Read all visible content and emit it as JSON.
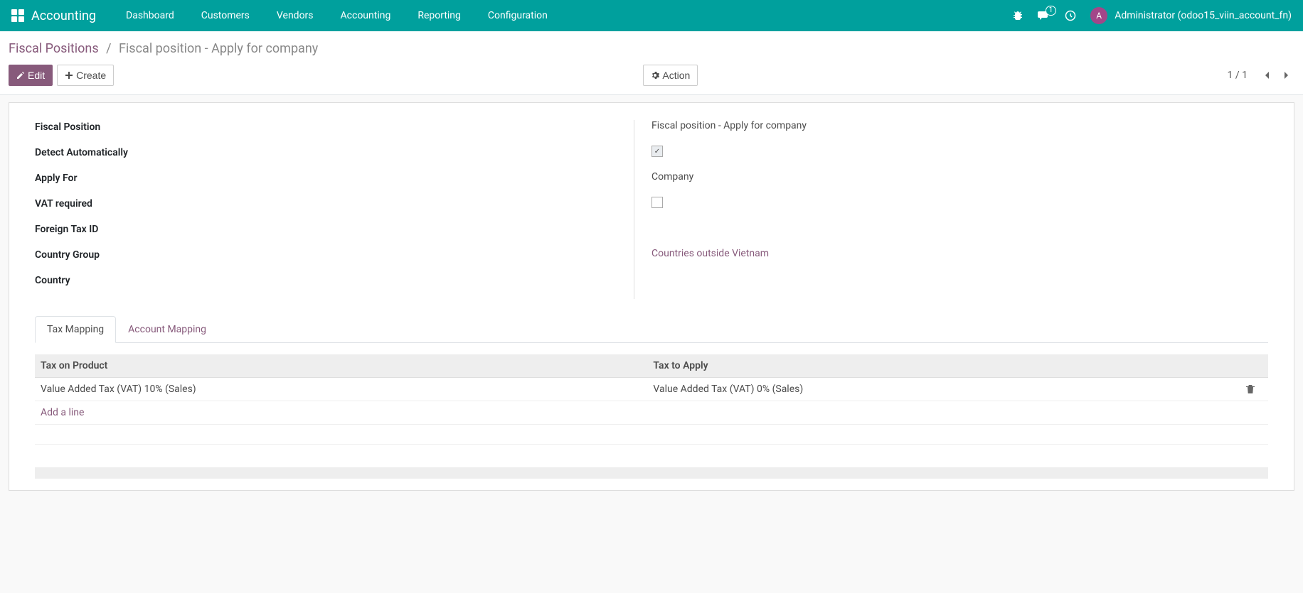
{
  "navbar": {
    "brand": "Accounting",
    "items": [
      "Dashboard",
      "Customers",
      "Vendors",
      "Accounting",
      "Reporting",
      "Configuration"
    ],
    "messages_badge": "1",
    "user_initial": "A",
    "user_name": "Administrator (odoo15_viin_account_fn)"
  },
  "breadcrumb": {
    "parent": "Fiscal Positions",
    "current": "Fiscal position - Apply for company"
  },
  "buttons": {
    "edit": "Edit",
    "create": "Create",
    "action": "Action"
  },
  "pager": {
    "text": "1 / 1"
  },
  "form": {
    "fiscal_position_label": "Fiscal Position",
    "fiscal_position_value": "Fiscal position - Apply for company",
    "detect_auto_label": "Detect Automatically",
    "detect_auto_checked": true,
    "apply_for_label": "Apply For",
    "apply_for_value": "Company",
    "vat_required_label": "VAT required",
    "vat_required_checked": false,
    "foreign_tax_id_label": "Foreign Tax ID",
    "foreign_tax_id_value": "",
    "country_group_label": "Country Group",
    "country_group_value": "Countries outside Vietnam",
    "country_label": "Country",
    "country_value": ""
  },
  "tabs": {
    "tax_mapping": "Tax Mapping",
    "account_mapping": "Account Mapping"
  },
  "tax_table": {
    "col_tax_on_product": "Tax on Product",
    "col_tax_to_apply": "Tax to Apply",
    "rows": [
      {
        "on_product": "Value Added Tax (VAT) 10% (Sales)",
        "to_apply": "Value Added Tax (VAT) 0% (Sales)"
      }
    ],
    "add_line": "Add a line"
  }
}
